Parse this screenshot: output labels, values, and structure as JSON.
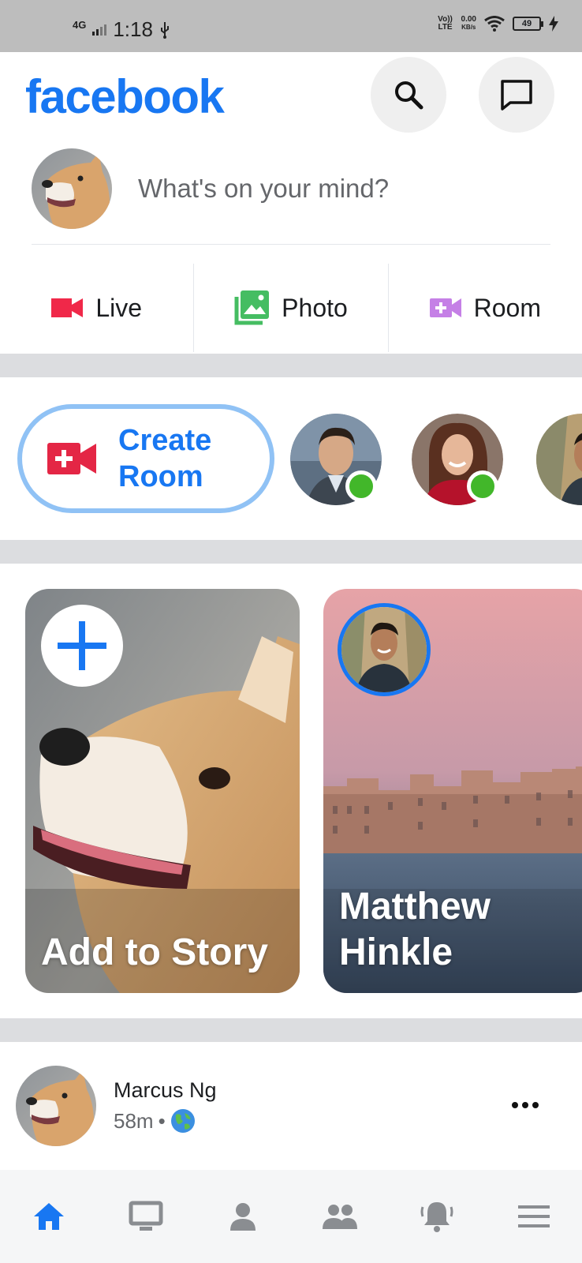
{
  "status_bar": {
    "network": "4G",
    "time": "1:18",
    "volte_label": "Vo)) LTE",
    "speed_value": "0.00",
    "speed_unit": "KB/s",
    "battery": "49"
  },
  "header": {
    "logo": "facebook",
    "icons": [
      "search-icon",
      "messenger-icon"
    ]
  },
  "composer": {
    "placeholder": "What's on your mind?"
  },
  "actions": [
    {
      "label": "Live",
      "icon": "video-camera-icon",
      "color": "#f02849"
    },
    {
      "label": "Photo",
      "icon": "photo-icon",
      "color": "#45bd62"
    },
    {
      "label": "Room",
      "icon": "room-icon",
      "color": "#c580e6"
    }
  ],
  "rooms": {
    "create_line1": "Create",
    "create_line2": "Room",
    "create_icon_color": "#e42645"
  },
  "stories": [
    {
      "label": "Add to Story"
    },
    {
      "label_line1": "Matthew",
      "label_line2": "Hinkle"
    }
  ],
  "post": {
    "author": "Marcus Ng",
    "time": "58m",
    "separator": "•",
    "privacy_icon": "globe-icon"
  },
  "bottom_nav": [
    "home-icon",
    "watch-icon",
    "profile-icon",
    "groups-icon",
    "notifications-icon",
    "menu-icon"
  ],
  "colors": {
    "brand": "#1877f2",
    "online": "#42b72a"
  }
}
